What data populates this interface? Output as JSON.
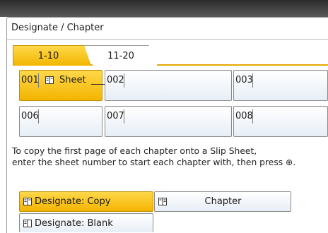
{
  "window": {
    "title": "Designate / Chapter"
  },
  "tabs": [
    {
      "label": "1-10",
      "active": true
    },
    {
      "label": "11-20",
      "active": false
    }
  ],
  "grid": {
    "row1": [
      {
        "num": "001",
        "label": "Sheet",
        "icon": "slip-sheet-icon",
        "selected": true
      },
      {
        "num": "002"
      },
      {
        "num": "003"
      }
    ],
    "row2": [
      {
        "num": "006"
      },
      {
        "num": "007"
      },
      {
        "num": "008"
      }
    ]
  },
  "instructions": {
    "line1": "To copy the first page of each chapter onto a Slip Sheet,",
    "line2": "enter the sheet number to start each chapter with, then press ⊕."
  },
  "buttons": {
    "designate_copy": "Designate: Copy",
    "chapter": "Chapter",
    "designate_blank": "Designate: Blank"
  },
  "colors": {
    "accent": "#f3b400",
    "accent_dark": "#c08c00",
    "cell_bg": "#e7eef6"
  }
}
